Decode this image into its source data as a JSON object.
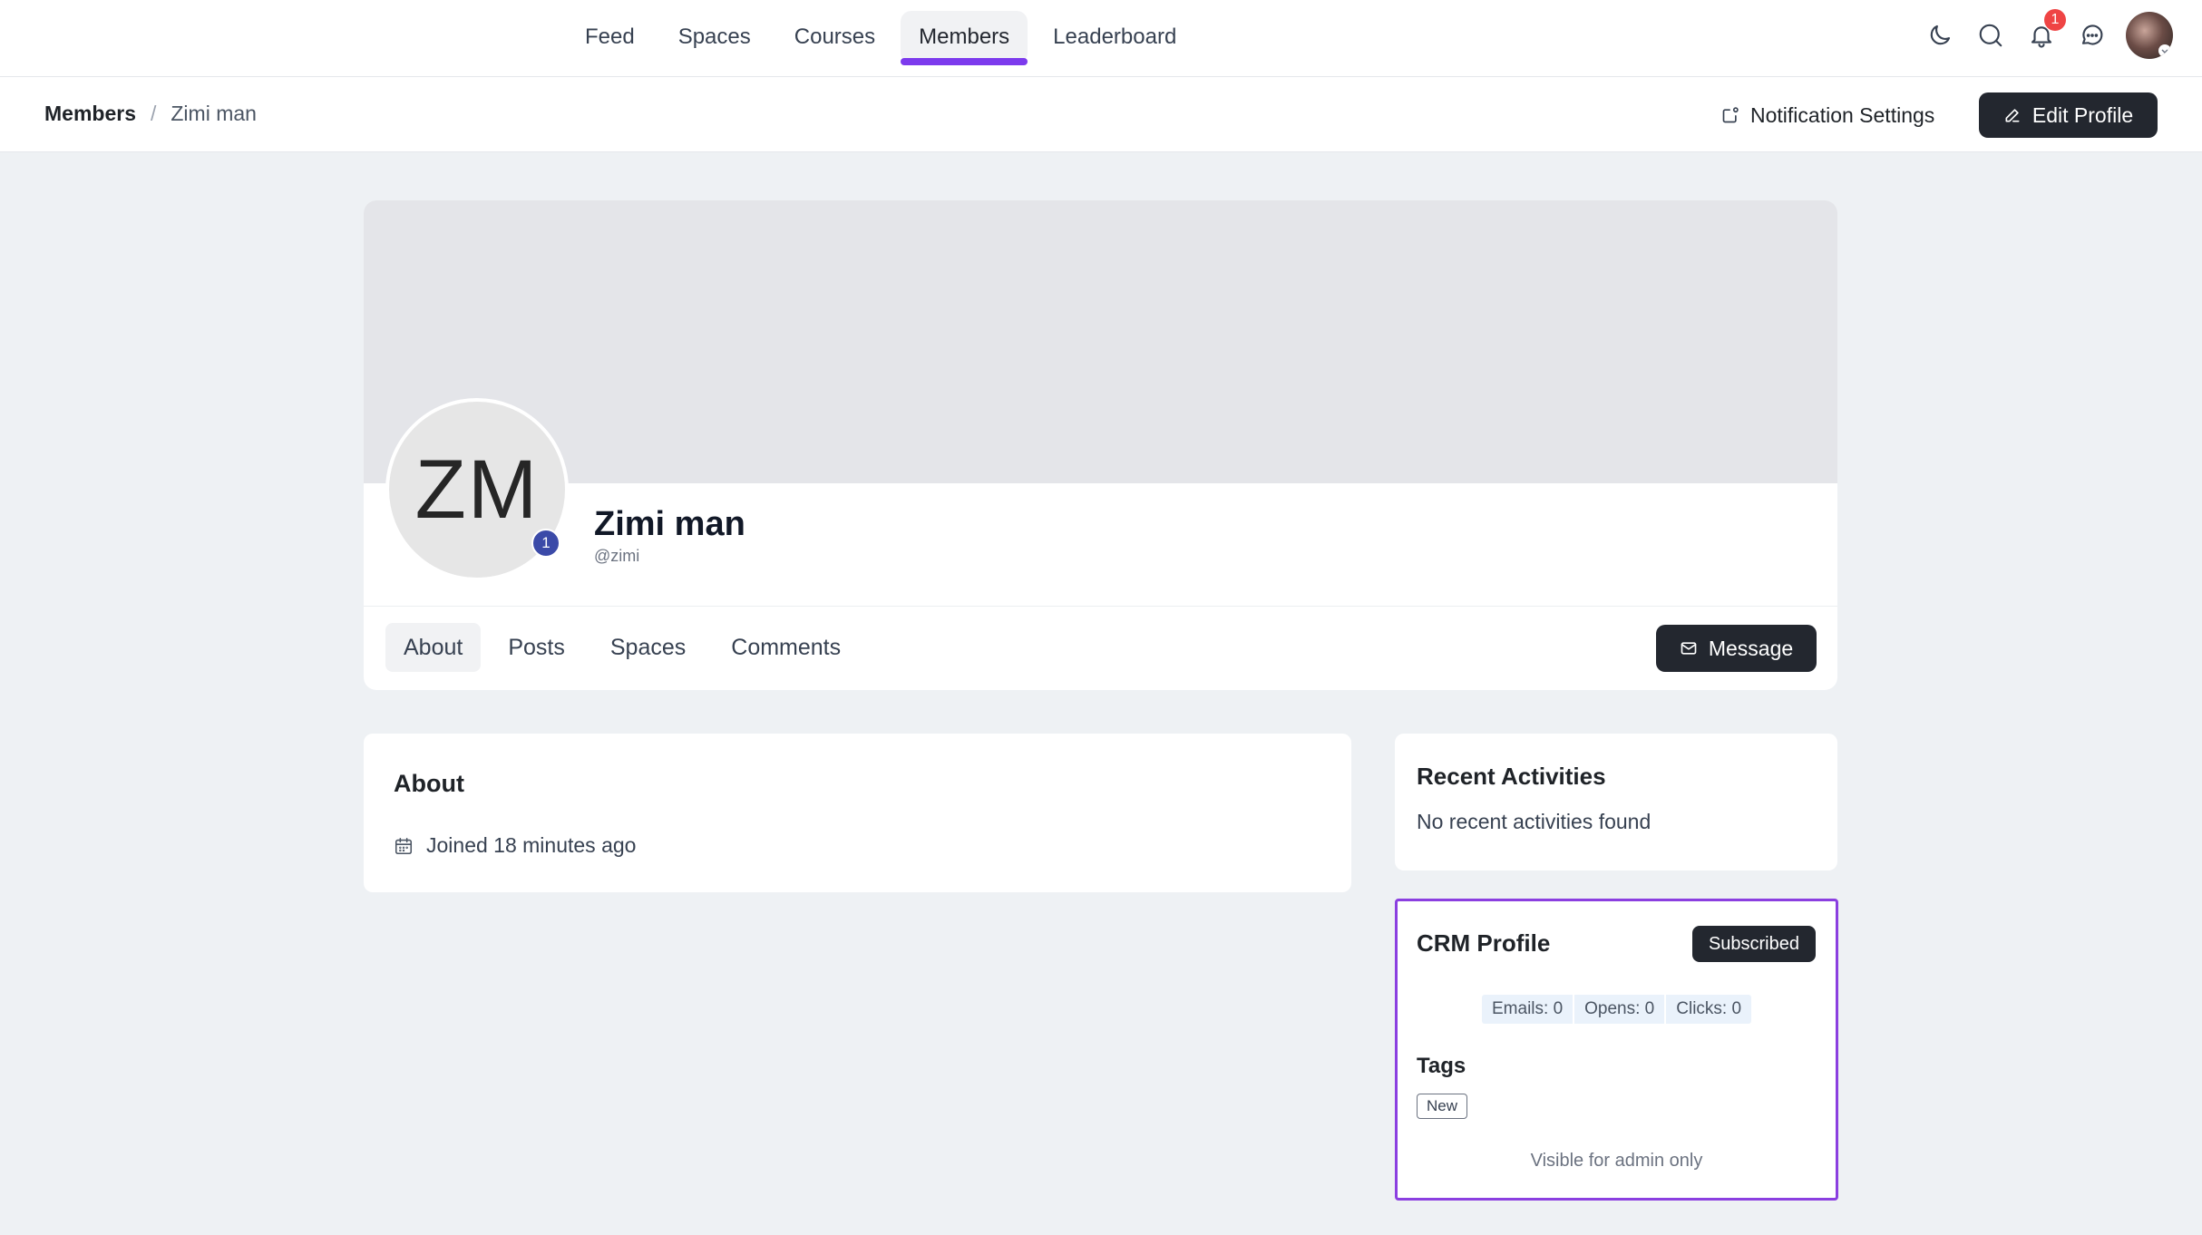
{
  "nav": {
    "links": [
      "Feed",
      "Spaces",
      "Courses",
      "Members",
      "Leaderboard"
    ],
    "active": "Members",
    "notification_count": "1",
    "accent_color": "#7c3aed"
  },
  "subbar": {
    "breadcrumb_root": "Members",
    "breadcrumb_separator": "/",
    "breadcrumb_current": "Zimi man",
    "notification_settings_label": "Notification Settings",
    "edit_profile_label": "Edit Profile"
  },
  "profile": {
    "initials": "ZM",
    "level": "1",
    "name": "Zimi man",
    "handle": "@zimi",
    "tabs": [
      "About",
      "Posts",
      "Spaces",
      "Comments"
    ],
    "active_tab": "About",
    "message_label": "Message"
  },
  "about": {
    "title": "About",
    "joined": "Joined 18 minutes ago"
  },
  "recent": {
    "title": "Recent Activities",
    "empty_text": "No recent activities found"
  },
  "crm": {
    "title": "CRM Profile",
    "status": "Subscribed",
    "stats": {
      "emails": "Emails: 0",
      "opens": "Opens: 0",
      "clicks": "Clicks: 0"
    },
    "tags_title": "Tags",
    "tags": [
      "New"
    ],
    "note": "Visible for admin only",
    "highlight_color": "#8b3fe0"
  }
}
